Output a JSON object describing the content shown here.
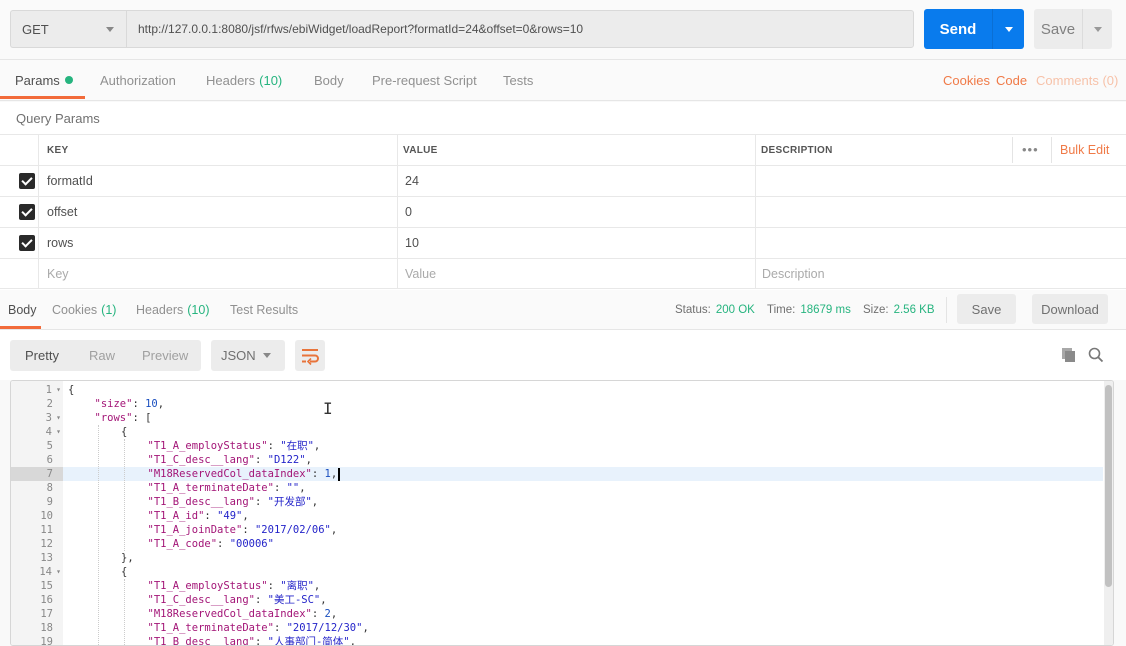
{
  "request": {
    "method": "GET",
    "url": "http://127.0.0.1:8080/jsf/rfws/ebiWidget/loadReport?formatId=24&offset=0&rows=10",
    "send_label": "Send",
    "save_label": "Save"
  },
  "request_tabs": [
    {
      "label": "Params",
      "active": true,
      "dot": true
    },
    {
      "label": "Authorization"
    },
    {
      "label": "Headers",
      "count": "(10)"
    },
    {
      "label": "Body"
    },
    {
      "label": "Pre-request Script"
    },
    {
      "label": "Tests"
    }
  ],
  "request_links": {
    "cookies": "Cookies",
    "code": "Code",
    "comments": "Comments (0)"
  },
  "query_params": {
    "title": "Query Params",
    "headers": {
      "key": "KEY",
      "value": "VALUE",
      "description": "DESCRIPTION"
    },
    "more_label": "•••",
    "bulk_edit": "Bulk Edit",
    "rows": [
      {
        "checked": true,
        "key": "formatId",
        "value": "24",
        "description": ""
      },
      {
        "checked": true,
        "key": "offset",
        "value": "0",
        "description": ""
      },
      {
        "checked": true,
        "key": "rows",
        "value": "10",
        "description": ""
      }
    ],
    "placeholders": {
      "key": "Key",
      "value": "Value",
      "description": "Description"
    }
  },
  "response_tabs": [
    {
      "label": "Body",
      "active": true
    },
    {
      "label": "Cookies",
      "count": "(1)"
    },
    {
      "label": "Headers",
      "count": "(10)"
    },
    {
      "label": "Test Results"
    }
  ],
  "response_status": {
    "status_label": "Status:",
    "status": "200 OK",
    "time_label": "Time:",
    "time": "18679 ms",
    "size_label": "Size:",
    "size": "2.56 KB",
    "save": "Save",
    "download": "Download"
  },
  "body_toolbar": {
    "views": [
      "Pretty",
      "Raw",
      "Preview"
    ],
    "active_view": "Pretty",
    "format": "JSON"
  },
  "editor": {
    "highlighted_line": 7,
    "lines": [
      {
        "n": "1",
        "fold": true,
        "indent": 0,
        "parts": [
          [
            "p",
            "{"
          ]
        ]
      },
      {
        "n": "2",
        "indent": 1,
        "parts": [
          [
            "k",
            "\"size\""
          ],
          [
            "p",
            ": "
          ],
          [
            "n",
            "10"
          ],
          [
            "p",
            ","
          ]
        ]
      },
      {
        "n": "3",
        "fold": true,
        "indent": 1,
        "parts": [
          [
            "k",
            "\"rows\""
          ],
          [
            "p",
            ": ["
          ]
        ]
      },
      {
        "n": "4",
        "fold": true,
        "indent": 2,
        "parts": [
          [
            "p",
            "{"
          ]
        ]
      },
      {
        "n": "5",
        "indent": 3,
        "parts": [
          [
            "k",
            "\"T1_A_employStatus\""
          ],
          [
            "p",
            ": "
          ],
          [
            "s",
            "\"在职\""
          ],
          [
            "p",
            ","
          ]
        ]
      },
      {
        "n": "6",
        "indent": 3,
        "parts": [
          [
            "k",
            "\"T1_C_desc__lang\""
          ],
          [
            "p",
            ": "
          ],
          [
            "s",
            "\"D122\""
          ],
          [
            "p",
            ","
          ]
        ]
      },
      {
        "n": "7",
        "indent": 3,
        "parts": [
          [
            "k",
            "\"M18ReservedCol_dataIndex\""
          ],
          [
            "p",
            ": "
          ],
          [
            "n",
            "1"
          ],
          [
            "p",
            ","
          ]
        ]
      },
      {
        "n": "8",
        "indent": 3,
        "parts": [
          [
            "k",
            "\"T1_A_terminateDate\""
          ],
          [
            "p",
            ": "
          ],
          [
            "s",
            "\"\""
          ],
          [
            "p",
            ","
          ]
        ]
      },
      {
        "n": "9",
        "indent": 3,
        "parts": [
          [
            "k",
            "\"T1_B_desc__lang\""
          ],
          [
            "p",
            ": "
          ],
          [
            "s",
            "\"开发部\""
          ],
          [
            "p",
            ","
          ]
        ]
      },
      {
        "n": "10",
        "indent": 3,
        "parts": [
          [
            "k",
            "\"T1_A_id\""
          ],
          [
            "p",
            ": "
          ],
          [
            "s",
            "\"49\""
          ],
          [
            "p",
            ","
          ]
        ]
      },
      {
        "n": "11",
        "indent": 3,
        "parts": [
          [
            "k",
            "\"T1_A_joinDate\""
          ],
          [
            "p",
            ": "
          ],
          [
            "s",
            "\"2017/02/06\""
          ],
          [
            "p",
            ","
          ]
        ]
      },
      {
        "n": "12",
        "indent": 3,
        "parts": [
          [
            "k",
            "\"T1_A_code\""
          ],
          [
            "p",
            ": "
          ],
          [
            "s",
            "\"00006\""
          ]
        ]
      },
      {
        "n": "13",
        "indent": 2,
        "parts": [
          [
            "p",
            "},"
          ]
        ]
      },
      {
        "n": "14",
        "fold": true,
        "indent": 2,
        "parts": [
          [
            "p",
            "{"
          ]
        ]
      },
      {
        "n": "15",
        "indent": 3,
        "parts": [
          [
            "k",
            "\"T1_A_employStatus\""
          ],
          [
            "p",
            ": "
          ],
          [
            "s",
            "\"离职\""
          ],
          [
            "p",
            ","
          ]
        ]
      },
      {
        "n": "16",
        "indent": 3,
        "parts": [
          [
            "k",
            "\"T1_C_desc__lang\""
          ],
          [
            "p",
            ": "
          ],
          [
            "s",
            "\"美工-SC\""
          ],
          [
            "p",
            ","
          ]
        ]
      },
      {
        "n": "17",
        "indent": 3,
        "parts": [
          [
            "k",
            "\"M18ReservedCol_dataIndex\""
          ],
          [
            "p",
            ": "
          ],
          [
            "n",
            "2"
          ],
          [
            "p",
            ","
          ]
        ]
      },
      {
        "n": "18",
        "indent": 3,
        "parts": [
          [
            "k",
            "\"T1_A_terminateDate\""
          ],
          [
            "p",
            ": "
          ],
          [
            "s",
            "\"2017/12/30\""
          ],
          [
            "p",
            ","
          ]
        ]
      },
      {
        "n": "19",
        "indent": 3,
        "parts": [
          [
            "k",
            "\"T1_B_desc__lang\""
          ],
          [
            "p",
            ": "
          ],
          [
            "s",
            "\"人事部门-简体\""
          ],
          [
            "p",
            ","
          ]
        ]
      }
    ]
  },
  "colors": {
    "accent": "#f26b3a",
    "send": "#097bed",
    "success": "#26b47f"
  }
}
